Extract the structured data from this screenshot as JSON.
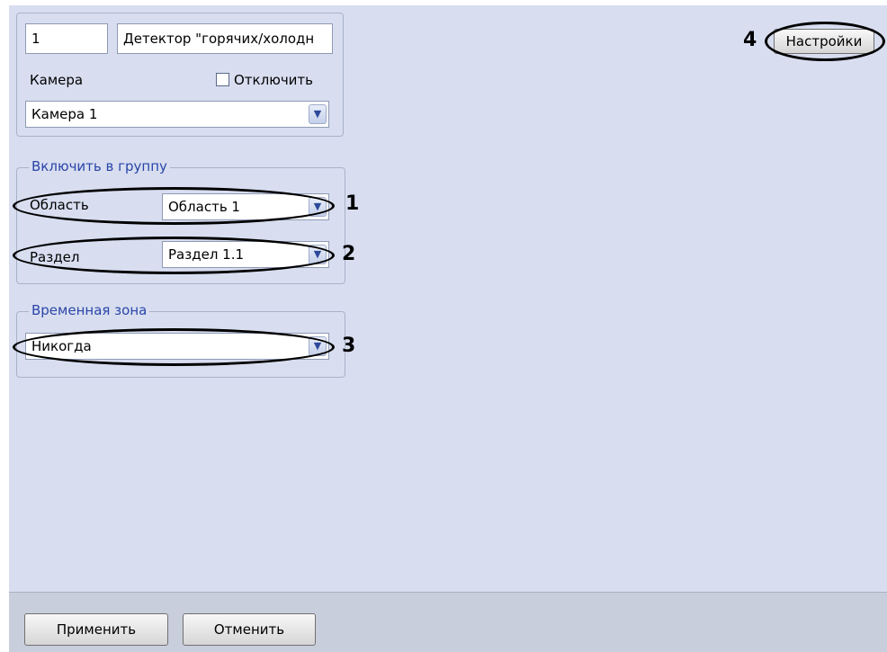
{
  "header": {
    "id_value": "1",
    "name_value": "Детектор \"горячих/холодн"
  },
  "camera": {
    "label": "Камера",
    "disable_label": "Отключить",
    "disable_checked": false,
    "selected": "Камера 1"
  },
  "group": {
    "title": "Включить в группу",
    "area_label": "Область",
    "area_value": "Область 1",
    "section_label": "Раздел",
    "section_value": "Раздел 1.1"
  },
  "time_zone": {
    "title": "Временная зона",
    "value": "Никогда"
  },
  "settings_button": "Настройки",
  "footer": {
    "apply": "Применить",
    "cancel": "Отменить"
  },
  "callouts": {
    "n1": "1",
    "n2": "2",
    "n3": "3",
    "n4": "4"
  }
}
